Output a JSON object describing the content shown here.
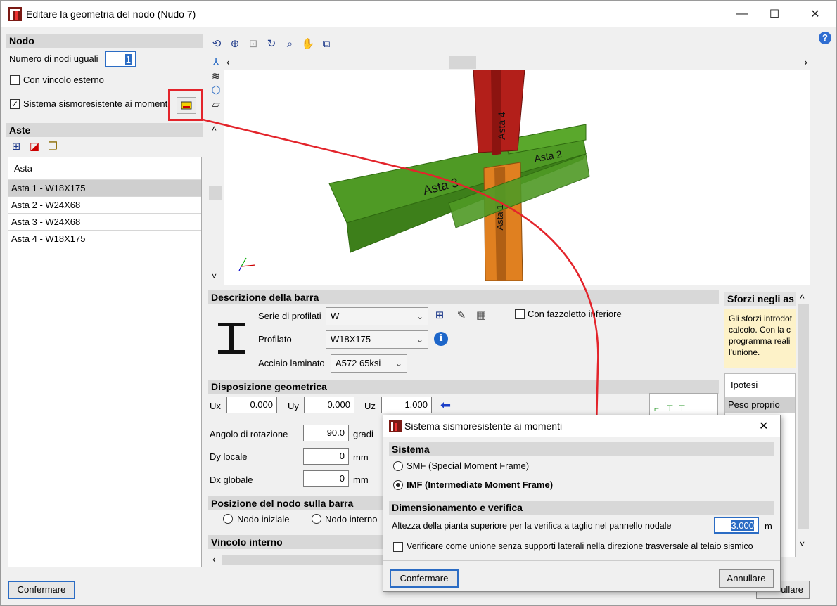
{
  "window": {
    "title": "Editare la geometria del nodo (Nudo 7)",
    "minimize": "—",
    "maximize": "☐",
    "close": "✕"
  },
  "nodo": {
    "header": "Nodo",
    "num_label": "Numero di nodi uguali",
    "num_value": "1",
    "vincolo_label": "Con vincolo esterno",
    "sistema_label": "Sistema sismoresistente ai momenti"
  },
  "aste": {
    "header": "Aste",
    "column": "Asta",
    "rows": [
      "Asta 1 - W18X175",
      "Asta 2 - W24X68",
      "Asta 3 - W24X68",
      "Asta 4 - W18X175"
    ]
  },
  "view": {
    "labels": [
      "Asta 4",
      "Asta 2",
      "Asta 3",
      "Asta 1"
    ]
  },
  "descrizione": {
    "header": "Descrizione della barra",
    "serie_label": "Serie di profilati",
    "serie_value": "W",
    "profilato_label": "Profilato",
    "profilato_value": "W18X175",
    "acciaio_label": "Acciaio laminato",
    "acciaio_value": "A572 65ksi",
    "fazzoletto_label": "Con fazzoletto inferiore"
  },
  "disposizione": {
    "header": "Disposizione geometrica",
    "ux_label": "Ux",
    "ux_value": "0.000",
    "uy_label": "Uy",
    "uy_value": "0.000",
    "uz_label": "Uz",
    "uz_value": "1.000",
    "angolo_label": "Angolo di rotazione",
    "angolo_value": "90.0",
    "angolo_unit": "gradi",
    "dy_label": "Dy locale",
    "dy_value": "0",
    "dy_unit": "mm",
    "dx_label": "Dx globale",
    "dx_value": "0",
    "dx_unit": "mm"
  },
  "posizione": {
    "header": "Posizione del nodo sulla barra",
    "iniziale": "Nodo iniziale",
    "interno": "Nodo interno"
  },
  "vincolo_interno": {
    "header": "Vincolo interno"
  },
  "sforzi": {
    "header": "Sforzi negli as",
    "note_lines": [
      "Gli sforzi introdot",
      "calcolo. Con la c",
      "programma reali",
      "l'unione."
    ],
    "ipotesi_header": "Ipotesi",
    "ipotesi_row": "Peso proprio"
  },
  "buttons": {
    "confermare": "Confermare",
    "annullare_partial": "ullare"
  },
  "dialog": {
    "title": "Sistema sismoresistente ai momenti",
    "sistema_header": "Sistema",
    "smf": "SMF (Special Moment Frame)",
    "imf": "IMF (Intermediate Moment Frame)",
    "dim_header": "Dimensionamento e verifica",
    "altezza_label": "Altezza della pianta superiore per la verifica a taglio nel pannello nodale",
    "altezza_value": "3.000",
    "altezza_unit": "m",
    "verificare_label": "Verificare come unione senza supporti laterali nella direzione trasversale al telaio sismico",
    "confermare": "Confermare",
    "annullare": "Annullare"
  },
  "colors": {
    "highlight": "#e3242b",
    "asta_red": "#b31f1a",
    "asta_green": "#4a9a22",
    "asta_orange": "#e08020"
  }
}
